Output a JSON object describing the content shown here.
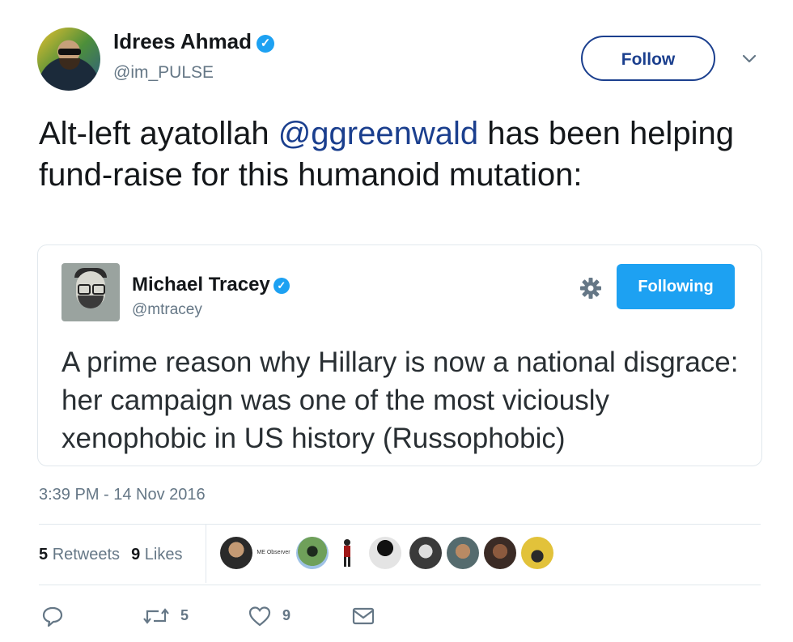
{
  "author": {
    "name": "Idrees Ahmad",
    "verified_icon": "verified-badge-icon",
    "handle": "@im_PULSE"
  },
  "follow_button": {
    "label": "Follow"
  },
  "menu_icon": "chevron-down-icon",
  "tweet": {
    "text_before": "Alt-left ayatollah ",
    "mention": "@ggreenwald",
    "text_after": " has been helping fund-raise for this humanoid mutation:"
  },
  "quoted_tweet": {
    "name": "Michael Tracey",
    "handle": "@mtracey",
    "settings_icon": "gear-icon",
    "following_label": "Following",
    "text": "A prime reason why Hillary is now a national disgrace: her campaign was one of the most viciously xenophobic in US history (Russophobic)"
  },
  "timestamp": "3:39 PM - 14 Nov 2016",
  "stats": {
    "retweets_count": "5",
    "retweets_label": "Retweets",
    "likes_count": "9",
    "likes_label": "Likes"
  },
  "liker_avatar_labels": [
    "ME Observer"
  ],
  "actions": {
    "reply_icon": "reply-icon",
    "retweet_icon": "retweet-icon",
    "retweet_count": "5",
    "like_icon": "heart-icon",
    "like_count": "9",
    "dm_icon": "envelope-icon"
  },
  "colors": {
    "link": "#1b3f8e",
    "twitter_blue": "#1da1f2",
    "secondary_text": "#657786"
  }
}
